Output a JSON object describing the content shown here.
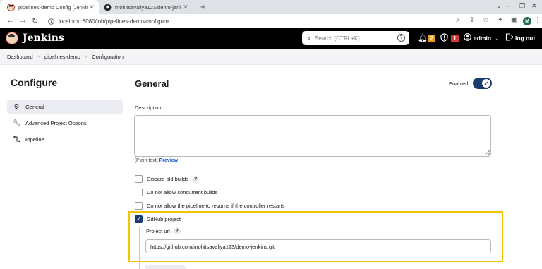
{
  "browser": {
    "tabs": [
      {
        "label": "pipelines-demo Config [Jenkins]",
        "active": true
      },
      {
        "label": "mohitsavaliya123/demo-jenkins",
        "active": false
      }
    ],
    "url": "localhost:8080/job/pipelines-demo/configure",
    "profile_initial": "M"
  },
  "header": {
    "title": "Jenkins",
    "search_placeholder": "Search (CTRL+K)",
    "notifications_count": "2",
    "security_count": "1",
    "user": "admin",
    "logout": "log out",
    "colors": {
      "notif": "#f19c1a",
      "security": "#d33833"
    }
  },
  "breadcrumb": [
    "Dashboard",
    "pipelines-demo",
    "Configuration"
  ],
  "sidebar": {
    "title": "Configure",
    "items": [
      {
        "label": "General",
        "icon": "gear-icon"
      },
      {
        "label": "Advanced Project Options",
        "icon": "wrench-icon"
      },
      {
        "label": "Pipeline",
        "icon": "pipeline-icon"
      }
    ]
  },
  "main": {
    "title": "General",
    "enabled_label": "Enabled",
    "enabled": true,
    "description_label": "Description",
    "plain_text": "[Plain text]",
    "preview": "Preview",
    "options": [
      {
        "label": "Discard old builds",
        "checked": false,
        "help": true
      },
      {
        "label": "Do not allow concurrent builds",
        "checked": false,
        "help": false
      },
      {
        "label": "Do not allow the pipeline to resume if the controller restarts",
        "checked": false,
        "help": false
      },
      {
        "label": "GitHub project",
        "checked": true,
        "help": false
      }
    ],
    "project_url_label": "Project url",
    "project_url_value": "https://github.com/mohitsavaliya123/demo-jenkins.git"
  }
}
